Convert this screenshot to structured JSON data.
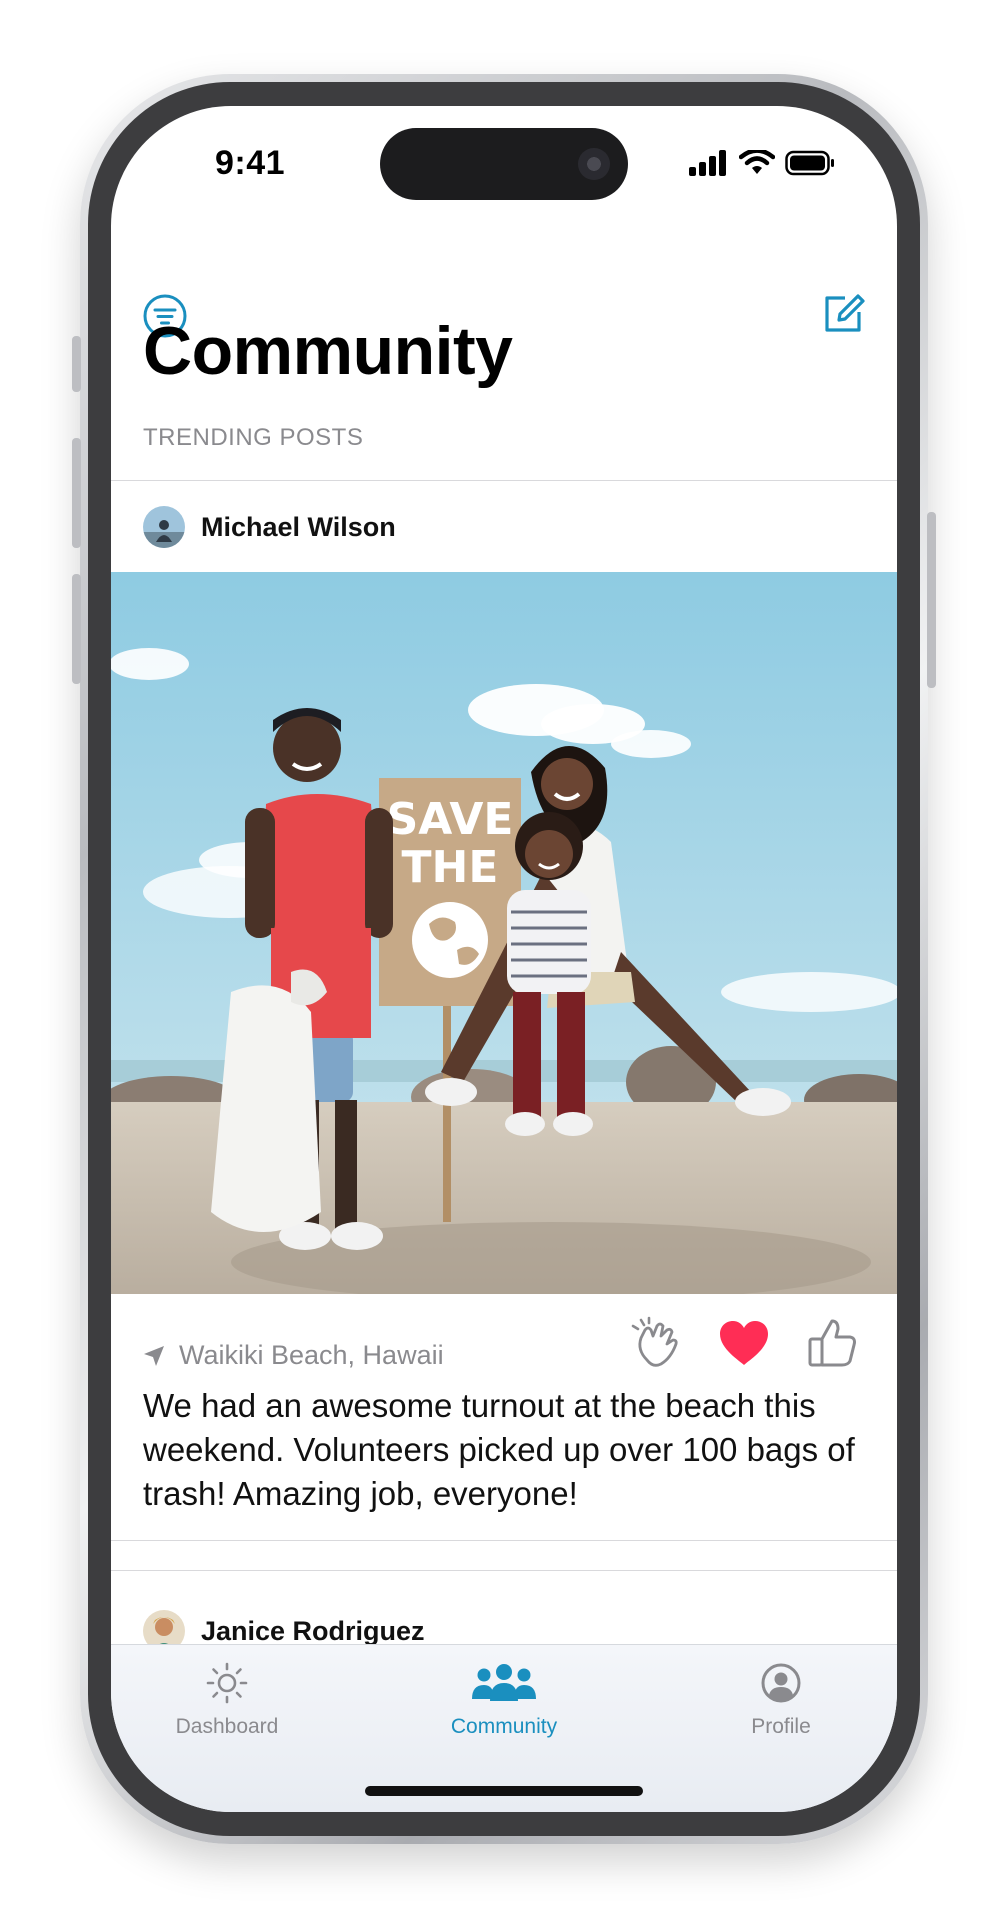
{
  "status_bar": {
    "time": "9:41"
  },
  "header": {
    "title": "Community",
    "section_label": "TRENDING POSTS",
    "accent_color": "#1a8fbf"
  },
  "posts": [
    {
      "author": "Michael Wilson",
      "location": "Waikiki Beach, Hawaii",
      "text": "We had an awesome turnout at the beach this weekend. Volunteers picked up over 100 bags of trash! Amazing job, everyone!",
      "photo_sign_text": [
        "SAVE",
        "THE"
      ],
      "reactions": [
        {
          "name": "clap",
          "active": false
        },
        {
          "name": "heart",
          "active": true,
          "color": "#ff2d55"
        },
        {
          "name": "thumbs-up",
          "active": false
        }
      ]
    },
    {
      "author": "Janice Rodriguez"
    }
  ],
  "tab_bar": {
    "tabs": [
      {
        "label": "Dashboard",
        "icon": "sun-icon",
        "active": false
      },
      {
        "label": "Community",
        "icon": "people-icon",
        "active": true
      },
      {
        "label": "Profile",
        "icon": "person-circle-icon",
        "active": false
      }
    ],
    "active_color": "#1a8fbf",
    "inactive_color": "#8a8a8e"
  }
}
